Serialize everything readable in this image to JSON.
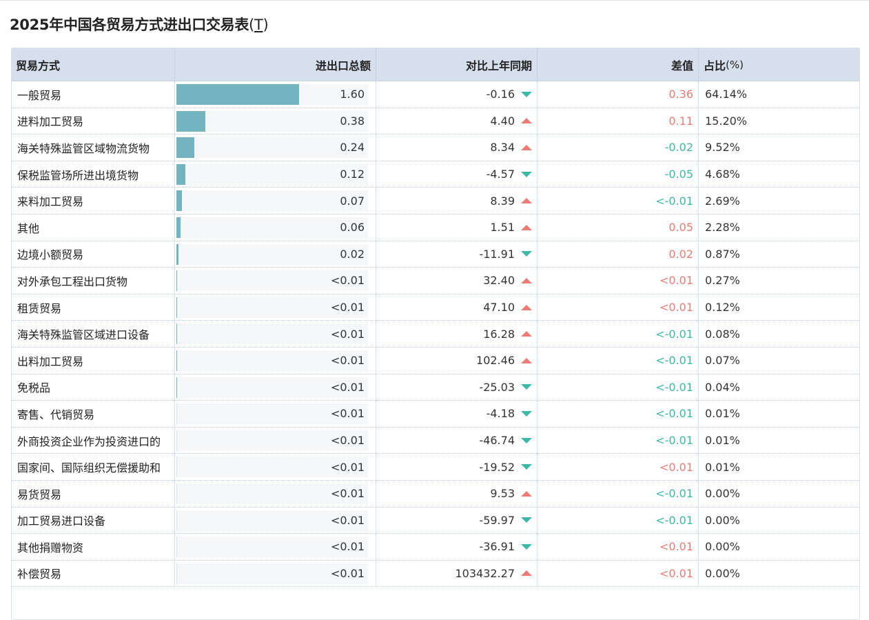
{
  "title": "2025年中国各贸易方式进出口交易表",
  "unit": {
    "open": "(",
    "label": "T",
    "close": ")"
  },
  "colors": {
    "bar": "#74b4c0",
    "up": "#ea7c74",
    "down": "#3cb8a8",
    "header_bg": "#d6e0ec"
  },
  "headers": {
    "trade_type": "贸易方式",
    "total": "进出口总额",
    "yoy": "对比上年同期",
    "diff": "差值",
    "share": "占比",
    "share_unit": "(%)"
  },
  "rows": [
    {
      "name": "一般贸易",
      "total": "1.60",
      "bar": 0.64,
      "yoy": "-0.16",
      "dir": "down",
      "diff": "0.36",
      "diff_sign": "pos",
      "share": "64.14%"
    },
    {
      "name": "进料加工贸易",
      "total": "0.38",
      "bar": 0.152,
      "yoy": "4.40",
      "dir": "up",
      "diff": "0.11",
      "diff_sign": "pos",
      "share": "15.20%"
    },
    {
      "name": "海关特殊监管区域物流货物",
      "total": "0.24",
      "bar": 0.095,
      "yoy": "8.34",
      "dir": "up",
      "diff": "-0.02",
      "diff_sign": "neg",
      "share": "9.52%"
    },
    {
      "name": "保税监管场所进出境货物",
      "total": "0.12",
      "bar": 0.047,
      "yoy": "-4.57",
      "dir": "down",
      "diff": "-0.05",
      "diff_sign": "neg",
      "share": "4.68%"
    },
    {
      "name": "来料加工贸易",
      "total": "0.07",
      "bar": 0.027,
      "yoy": "8.39",
      "dir": "up",
      "diff": "<-0.01",
      "diff_sign": "neg",
      "share": "2.69%"
    },
    {
      "name": "其他",
      "total": "0.06",
      "bar": 0.023,
      "yoy": "1.51",
      "dir": "up",
      "diff": "0.05",
      "diff_sign": "pos",
      "share": "2.28%"
    },
    {
      "name": "边境小额贸易",
      "total": "0.02",
      "bar": 0.009,
      "yoy": "-11.91",
      "dir": "down",
      "diff": "0.02",
      "diff_sign": "pos",
      "share": "0.87%"
    },
    {
      "name": "对外承包工程出口货物",
      "total": "<0.01",
      "bar": 0.003,
      "yoy": "32.40",
      "dir": "up",
      "diff": "<0.01",
      "diff_sign": "pos",
      "share": "0.27%"
    },
    {
      "name": "租赁贸易",
      "total": "<0.01",
      "bar": 0.003,
      "yoy": "47.10",
      "dir": "up",
      "diff": "<0.01",
      "diff_sign": "pos",
      "share": "0.12%"
    },
    {
      "name": "海关特殊监管区域进口设备",
      "total": "<0.01",
      "bar": 0.003,
      "yoy": "16.28",
      "dir": "up",
      "diff": "<-0.01",
      "diff_sign": "neg",
      "share": "0.08%"
    },
    {
      "name": "出料加工贸易",
      "total": "<0.01",
      "bar": 0.003,
      "yoy": "102.46",
      "dir": "up",
      "diff": "<-0.01",
      "diff_sign": "neg",
      "share": "0.07%"
    },
    {
      "name": "免税品",
      "total": "<0.01",
      "bar": 0.003,
      "yoy": "-25.03",
      "dir": "down",
      "diff": "<-0.01",
      "diff_sign": "neg",
      "share": "0.04%"
    },
    {
      "name": "寄售、代销贸易",
      "total": "<0.01",
      "bar": 0,
      "yoy": "-4.18",
      "dir": "down",
      "diff": "<-0.01",
      "diff_sign": "neg",
      "share": "0.01%"
    },
    {
      "name": "外商投资企业作为投资进口的",
      "total": "<0.01",
      "bar": 0,
      "yoy": "-46.74",
      "dir": "down",
      "diff": "<-0.01",
      "diff_sign": "neg",
      "share": "0.01%"
    },
    {
      "name": "国家间、国际组织无偿援助和",
      "total": "<0.01",
      "bar": 0,
      "yoy": "-19.52",
      "dir": "down",
      "diff": "<0.01",
      "diff_sign": "pos",
      "share": "0.01%"
    },
    {
      "name": "易货贸易",
      "total": "<0.01",
      "bar": 0,
      "yoy": "9.53",
      "dir": "up",
      "diff": "<-0.01",
      "diff_sign": "neg",
      "share": "0.00%"
    },
    {
      "name": "加工贸易进口设备",
      "total": "<0.01",
      "bar": 0,
      "yoy": "-59.97",
      "dir": "down",
      "diff": "<-0.01",
      "diff_sign": "neg",
      "share": "0.00%"
    },
    {
      "name": "其他捐赠物资",
      "total": "<0.01",
      "bar": 0,
      "yoy": "-36.91",
      "dir": "down",
      "diff": "<0.01",
      "diff_sign": "pos",
      "share": "0.00%"
    },
    {
      "name": "补偿贸易",
      "total": "<0.01",
      "bar": 0,
      "yoy": "103432.27",
      "dir": "up",
      "diff": "<0.01",
      "diff_sign": "pos",
      "share": "0.00%"
    }
  ]
}
